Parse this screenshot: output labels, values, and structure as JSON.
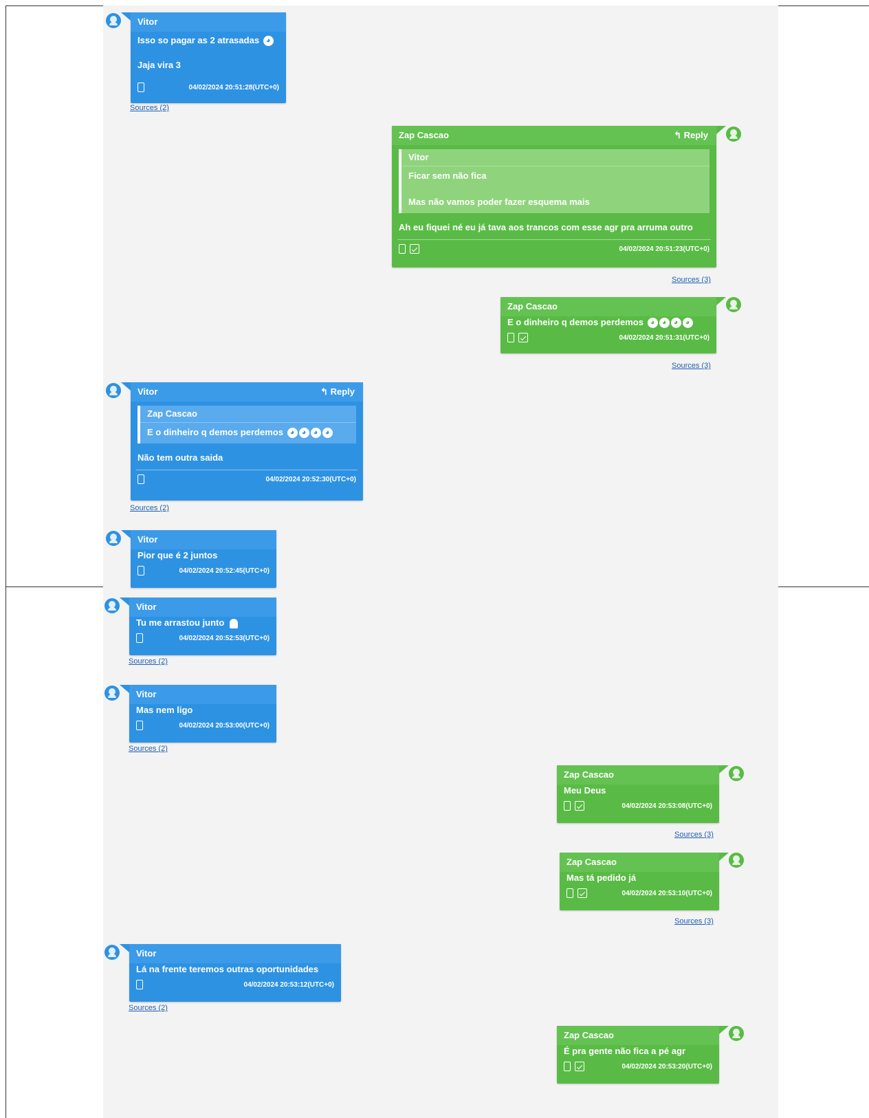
{
  "reply_label": "Reply",
  "sources_label": "Sources (2)",
  "sources_label_3": "Sources (3)",
  "messages": [
    {
      "sender": "Vitor",
      "lines": [
        "Isso so pagar as 2 atrasadas",
        "Jaja vira 3"
      ],
      "emoji": "😩",
      "timestamp": "04/02/2024 20:51:28(UTC+0)"
    },
    {
      "sender": "Zap Cascao",
      "quote_sender": "Vitor",
      "quote_lines": [
        "Ficar sem não fica",
        "Mas não vamos poder fazer esquema mais"
      ],
      "text": "Ah eu fiquei né eu já tava aos trancos com esse agr pra arruma outro",
      "timestamp": "04/02/2024 20:51:23(UTC+0)"
    },
    {
      "sender": "Zap Cascao",
      "text": "E o dinheiro q demos perdemos",
      "emojis": "😩😩😩😩",
      "timestamp": "04/02/2024 20:51:31(UTC+0)"
    },
    {
      "sender": "Vitor",
      "quote_sender": "Zap Cascao",
      "quote_text": "E o dinheiro q demos perdemos",
      "quote_emojis": "😩😩😩😩",
      "text": "Não tem outra saida",
      "timestamp": "04/02/2024 20:52:30(UTC+0)"
    },
    {
      "sender": "Vitor",
      "text": "Pior que é 2 juntos",
      "timestamp": "04/02/2024 20:52:45(UTC+0)"
    },
    {
      "sender": "Vitor",
      "text": "Tu me arrastou junto",
      "emoji": "👤",
      "timestamp": "04/02/2024 20:52:53(UTC+0)"
    },
    {
      "sender": "Vitor",
      "text": "Mas nem ligo",
      "timestamp": "04/02/2024 20:53:00(UTC+0)"
    },
    {
      "sender": "Zap Cascao",
      "text": "Meu Deus",
      "timestamp": "04/02/2024 20:53:08(UTC+0)"
    },
    {
      "sender": "Zap Cascao",
      "text": "Mas tá pedido já",
      "timestamp": "04/02/2024 20:53:10(UTC+0)"
    },
    {
      "sender": "Vitor",
      "text": "Lá na frente teremos outras oportunidades",
      "timestamp": "04/02/2024 20:53:12(UTC+0)"
    },
    {
      "sender": "Zap Cascao",
      "text": "É pra gente não fica a pé agr",
      "timestamp": "04/02/2024 20:53:20(UTC+0)"
    }
  ]
}
